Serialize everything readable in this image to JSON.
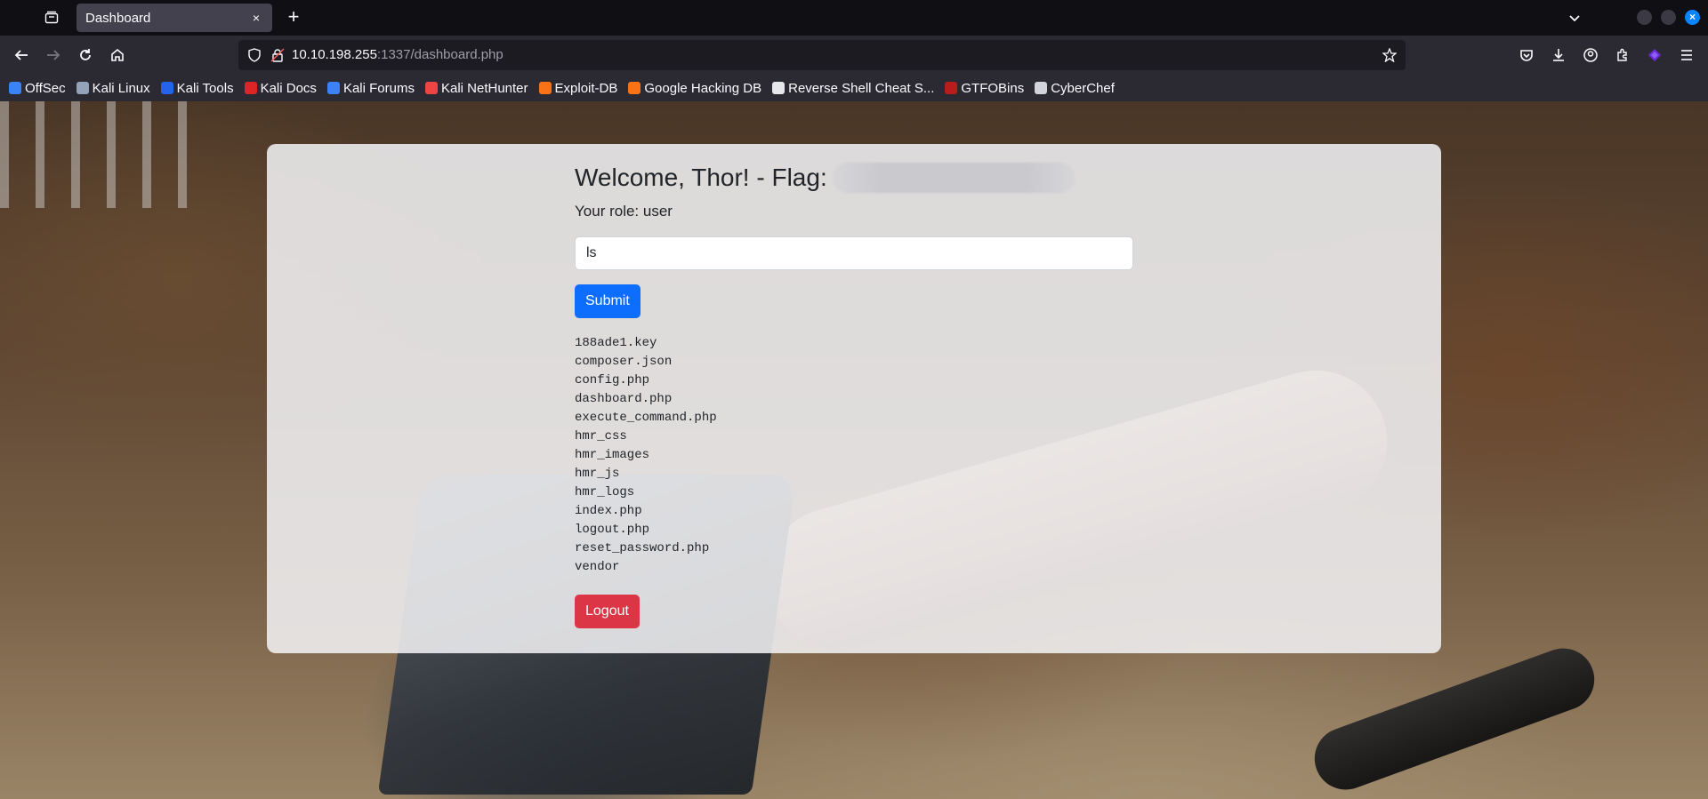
{
  "browser": {
    "tab": {
      "title": "Dashboard",
      "close": "×"
    },
    "new_tab": "+",
    "url": {
      "host": "10.10.198.255",
      "rest": ":1337/dashboard.php"
    },
    "window_close": "×",
    "bookmarks": [
      {
        "label": "OffSec",
        "icon": "offsec-icon",
        "color": "#3b82f6"
      },
      {
        "label": "Kali Linux",
        "icon": "kali-linux-icon",
        "color": "#94a3b8"
      },
      {
        "label": "Kali Tools",
        "icon": "kali-tools-icon",
        "color": "#2563eb"
      },
      {
        "label": "Kali Docs",
        "icon": "kali-docs-icon",
        "color": "#dc2626"
      },
      {
        "label": "Kali Forums",
        "icon": "kali-forums-icon",
        "color": "#3b82f6"
      },
      {
        "label": "Kali NetHunter",
        "icon": "kali-nethunter-icon",
        "color": "#ef4444"
      },
      {
        "label": "Exploit-DB",
        "icon": "exploit-db-icon",
        "color": "#f97316"
      },
      {
        "label": "Google Hacking DB",
        "icon": "google-hacking-db-icon",
        "color": "#f97316"
      },
      {
        "label": "Reverse Shell Cheat S...",
        "icon": "reverse-shell-icon",
        "color": "#e5e7eb"
      },
      {
        "label": "GTFOBins",
        "icon": "gtfobins-icon",
        "color": "#b91c1c"
      },
      {
        "label": "CyberChef",
        "icon": "cyberchef-icon",
        "color": "#d1d5db"
      }
    ]
  },
  "page": {
    "welcome": "Welcome, Thor! - Flag:",
    "role": "Your role: user",
    "command_value": "ls",
    "submit_label": "Submit",
    "output": [
      "188ade1.key",
      "composer.json",
      "config.php",
      "dashboard.php",
      "execute_command.php",
      "hmr_css",
      "hmr_images",
      "hmr_js",
      "hmr_logs",
      "index.php",
      "logout.php",
      "reset_password.php",
      "vendor"
    ],
    "logout_label": "Logout"
  }
}
